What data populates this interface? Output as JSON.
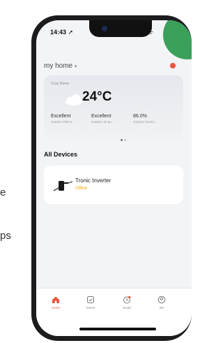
{
  "side_text": {
    "line1": "e",
    "line2": "ps"
  },
  "status_bar": {
    "time": "14:43",
    "icons": "ııl ᯤ"
  },
  "header": {
    "home_name": "my home",
    "chevron": "▾"
  },
  "weather": {
    "label": "Cozy Home",
    "temperature": "24°C",
    "stats": [
      {
        "value": "Excellent",
        "label": "Outdoor PM2.5"
      },
      {
        "value": "Excellent",
        "label": "Outdoor air qu..."
      },
      {
        "value": "86.0%",
        "label": "Outdoor humid..."
      }
    ],
    "page_indicator": {
      "current": 1,
      "total": 2
    }
  },
  "devices": {
    "section_title": "All Devices",
    "items": [
      {
        "name": "Tronic Inverter",
        "status": "Offline",
        "status_color": "#f0a800"
      }
    ]
  },
  "tabbar": {
    "tabs": [
      {
        "label": "Home",
        "icon": "home-icon",
        "active": true
      },
      {
        "label": "Scene",
        "icon": "scene-icon",
        "active": false
      },
      {
        "label": "Smart",
        "icon": "smart-icon",
        "active": false
      },
      {
        "label": "Me",
        "icon": "me-icon",
        "active": false
      }
    ]
  },
  "colors": {
    "accent": "#e8573f",
    "offline": "#f0a800",
    "brand_green": "#3aa05a"
  }
}
